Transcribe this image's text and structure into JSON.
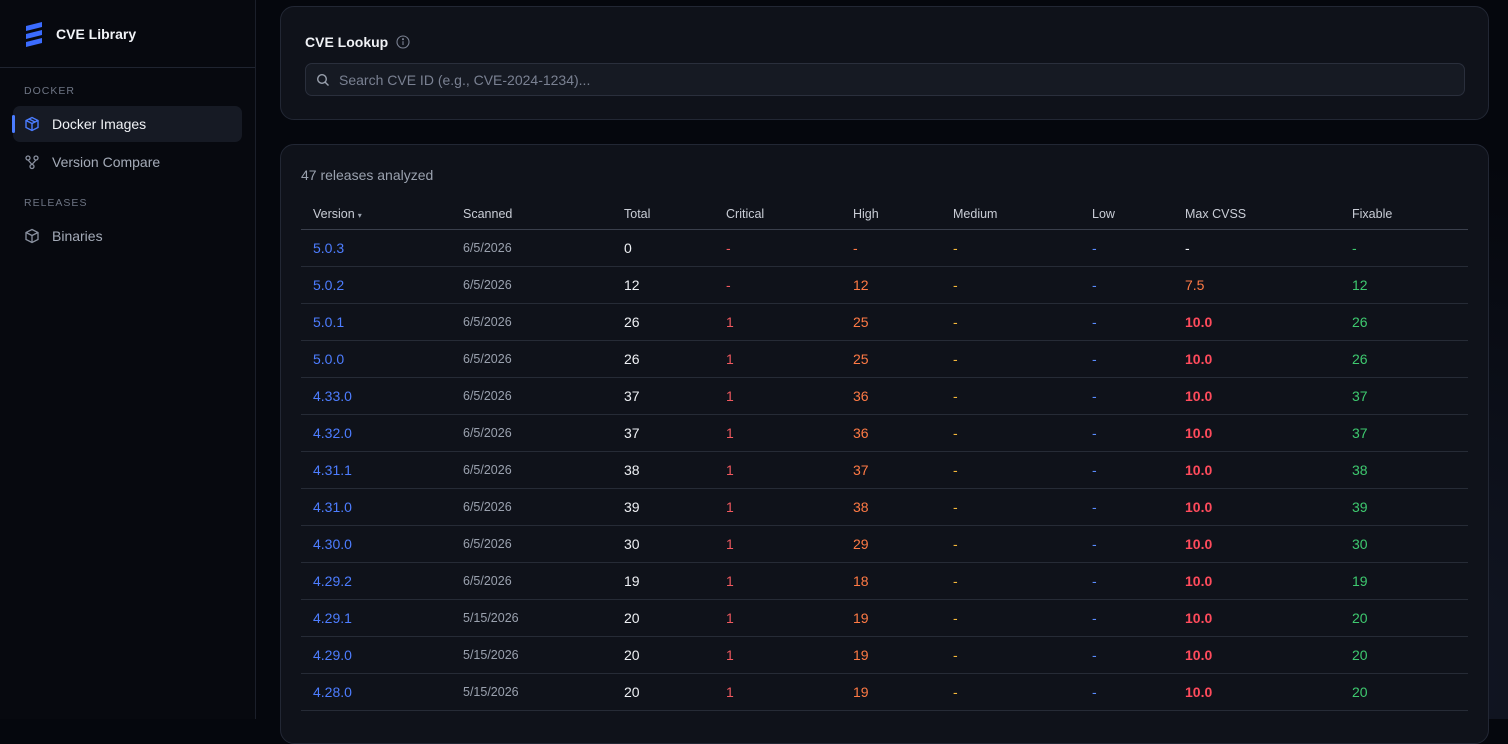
{
  "app": {
    "name": "CVE Library"
  },
  "sidebar": {
    "sections": [
      {
        "label": "DOCKER",
        "items": [
          {
            "label": "Docker Images",
            "icon": "cube-icon",
            "active": true
          },
          {
            "label": "Version Compare",
            "icon": "compare-icon",
            "active": false
          }
        ]
      },
      {
        "label": "RELEASES",
        "items": [
          {
            "label": "Binaries",
            "icon": "package-icon",
            "active": false
          }
        ]
      }
    ]
  },
  "lookup": {
    "title": "CVE Lookup",
    "placeholder": "Search CVE ID (e.g., CVE-2024-1234)..."
  },
  "releases": {
    "count_text": "47 releases analyzed",
    "columns": [
      "Version",
      "Scanned",
      "Total",
      "Critical",
      "High",
      "Medium",
      "Low",
      "Max CVSS",
      "Fixable"
    ],
    "sort_indicator": "▾",
    "rows": [
      {
        "version": "5.0.3",
        "scanned": "6/5/2026",
        "total": "0",
        "critical": "-",
        "high": "-",
        "medium": "-",
        "low": "-",
        "max_cvss": "-",
        "fixable": "-"
      },
      {
        "version": "5.0.2",
        "scanned": "6/5/2026",
        "total": "12",
        "critical": "-",
        "high": "12",
        "medium": "-",
        "low": "-",
        "max_cvss": "7.5",
        "fixable": "12"
      },
      {
        "version": "5.0.1",
        "scanned": "6/5/2026",
        "total": "26",
        "critical": "1",
        "high": "25",
        "medium": "-",
        "low": "-",
        "max_cvss": "10.0",
        "fixable": "26"
      },
      {
        "version": "5.0.0",
        "scanned": "6/5/2026",
        "total": "26",
        "critical": "1",
        "high": "25",
        "medium": "-",
        "low": "-",
        "max_cvss": "10.0",
        "fixable": "26"
      },
      {
        "version": "4.33.0",
        "scanned": "6/5/2026",
        "total": "37",
        "critical": "1",
        "high": "36",
        "medium": "-",
        "low": "-",
        "max_cvss": "10.0",
        "fixable": "37"
      },
      {
        "version": "4.32.0",
        "scanned": "6/5/2026",
        "total": "37",
        "critical": "1",
        "high": "36",
        "medium": "-",
        "low": "-",
        "max_cvss": "10.0",
        "fixable": "37"
      },
      {
        "version": "4.31.1",
        "scanned": "6/5/2026",
        "total": "38",
        "critical": "1",
        "high": "37",
        "medium": "-",
        "low": "-",
        "max_cvss": "10.0",
        "fixable": "38"
      },
      {
        "version": "4.31.0",
        "scanned": "6/5/2026",
        "total": "39",
        "critical": "1",
        "high": "38",
        "medium": "-",
        "low": "-",
        "max_cvss": "10.0",
        "fixable": "39"
      },
      {
        "version": "4.30.0",
        "scanned": "6/5/2026",
        "total": "30",
        "critical": "1",
        "high": "29",
        "medium": "-",
        "low": "-",
        "max_cvss": "10.0",
        "fixable": "30"
      },
      {
        "version": "4.29.2",
        "scanned": "6/5/2026",
        "total": "19",
        "critical": "1",
        "high": "18",
        "medium": "-",
        "low": "-",
        "max_cvss": "10.0",
        "fixable": "19"
      },
      {
        "version": "4.29.1",
        "scanned": "5/15/2026",
        "total": "20",
        "critical": "1",
        "high": "19",
        "medium": "-",
        "low": "-",
        "max_cvss": "10.0",
        "fixable": "20"
      },
      {
        "version": "4.29.0",
        "scanned": "5/15/2026",
        "total": "20",
        "critical": "1",
        "high": "19",
        "medium": "-",
        "low": "-",
        "max_cvss": "10.0",
        "fixable": "20"
      },
      {
        "version": "4.28.0",
        "scanned": "5/15/2026",
        "total": "20",
        "critical": "1",
        "high": "19",
        "medium": "-",
        "low": "-",
        "max_cvss": "10.0",
        "fixable": "20"
      }
    ]
  },
  "colors": {
    "accent": "#4a7cff",
    "critical": "#f0595f",
    "high": "#ff7a45",
    "medium": "#f5b83a",
    "low": "#5a8cff",
    "fixable": "#3ec96f"
  }
}
